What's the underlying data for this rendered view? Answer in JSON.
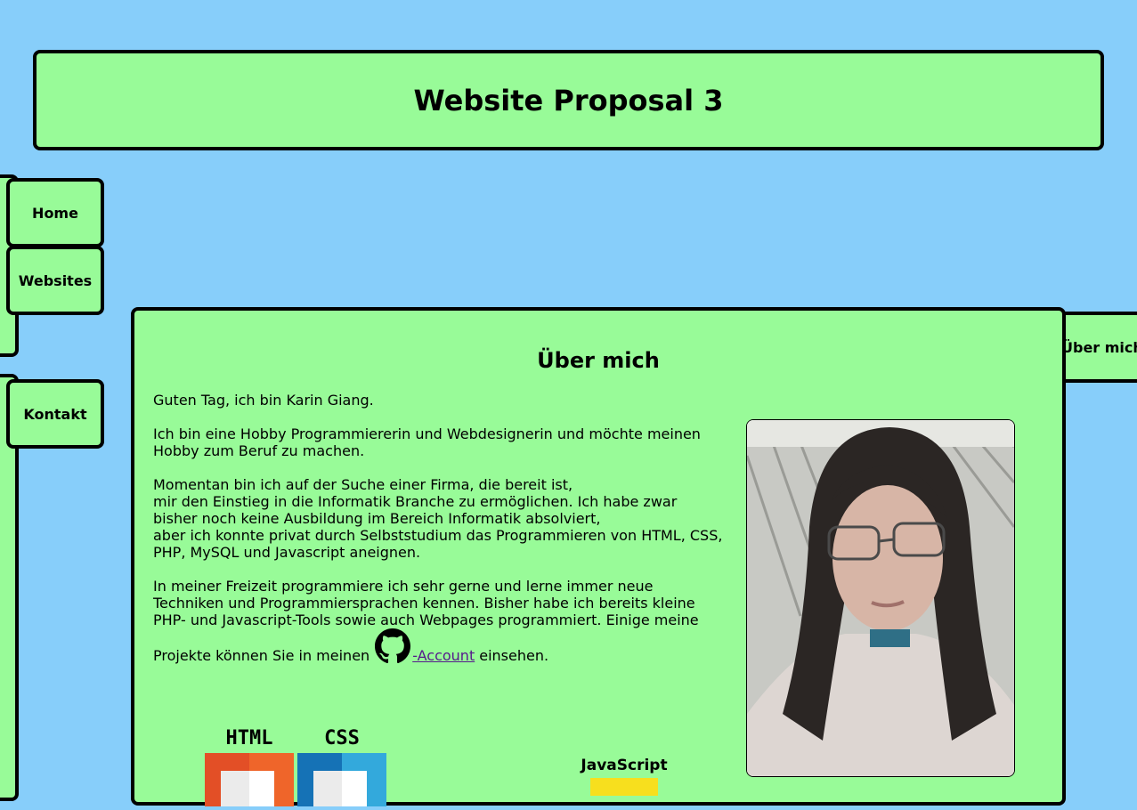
{
  "header": {
    "title": "Website Proposal 3"
  },
  "nav": {
    "home": "Home",
    "websites": "Websites",
    "kontakt": "Kontakt",
    "ueber_mich": "Über mich"
  },
  "main": {
    "heading": "Über mich",
    "greeting": "Guten Tag, ich bin Karin Giang.",
    "para1": "Ich bin eine Hobby Programmiererin und Webdesignerin und möchte meinen Hobby zum Beruf zu machen.",
    "para2_line1": "Momentan bin ich auf der Suche einer Firma, die bereit ist,",
    "para2_line2": "mir den Einstieg in die Informatik Branche zu ermöglichen. Ich habe zwar bisher noch keine Ausbildung im Bereich Informatik absolviert,",
    "para2_line3": "aber ich konnte privat durch Selbststudium das Programmieren von HTML, CSS, PHP, MySQL und Javascript aneignen.",
    "para3": "In meiner Freizeit programmiere ich sehr gerne und lerne immer neue Techniken und Programmiersprachen kennen. Bisher habe ich bereits kleine PHP- und Javascript-Tools sowie auch Webpages programmiert. Einige meine",
    "projects_prefix": "Projekte können Sie in meinen",
    "account_link": "-Account",
    "projects_suffix": "einsehen."
  },
  "logos": {
    "html_label": "HTML",
    "css_label": "CSS",
    "js_label": "JavaScript"
  },
  "icons": {
    "github": "github-icon"
  },
  "colors": {
    "background": "#87CEFA",
    "panel": "#98FB98",
    "border": "#000000"
  }
}
